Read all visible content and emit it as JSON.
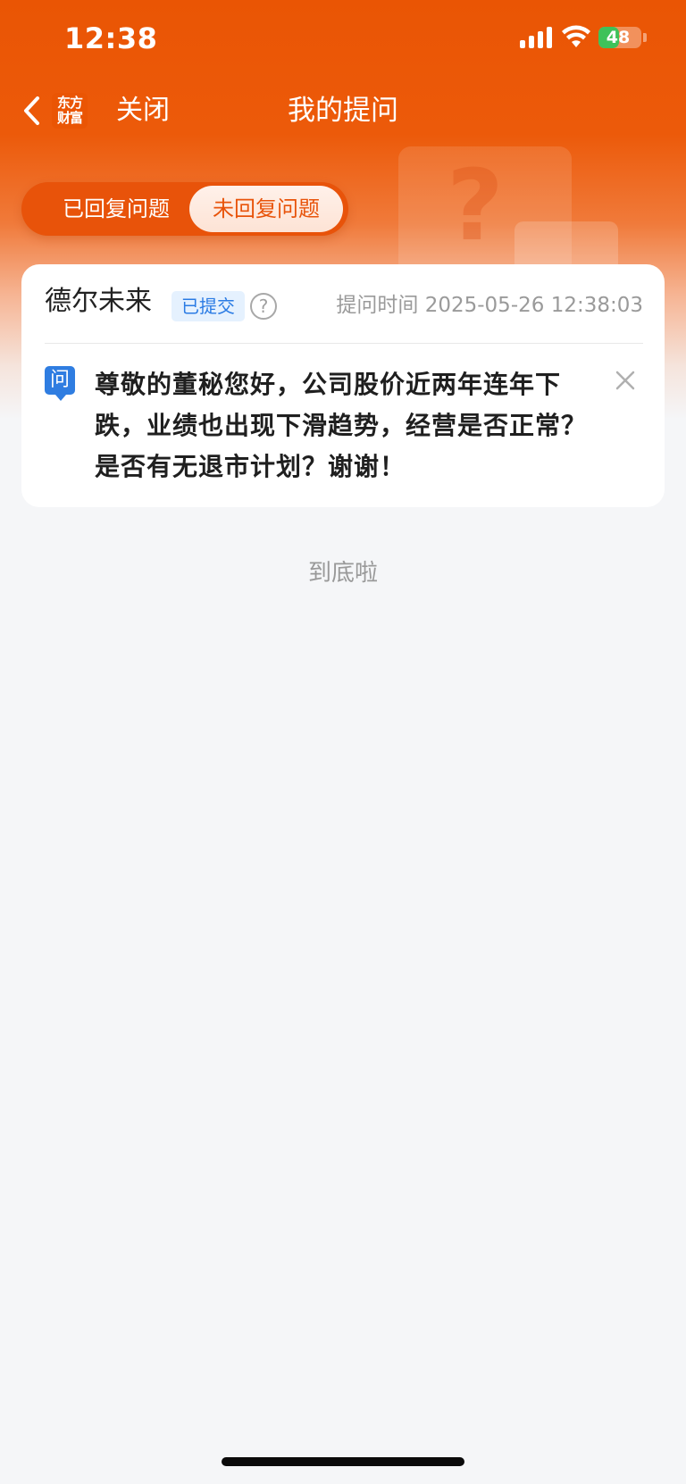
{
  "status_bar": {
    "time": "12:38",
    "battery_level": "48",
    "battery_fraction": 0.48,
    "icons": [
      "signal-icon",
      "wifi-icon",
      "battery-charging-icon"
    ]
  },
  "nav": {
    "back_icon": "chevron-left-icon",
    "brand_logo_lines": [
      "东方",
      "财富"
    ],
    "close_label": "关闭",
    "title": "我的提问"
  },
  "tabs": [
    {
      "label": "已回复问题",
      "active": false
    },
    {
      "label": "未回复问题",
      "active": true
    }
  ],
  "question_card": {
    "company": "德尔未来",
    "status": "已提交",
    "help_icon": "?",
    "time_label": "提问时间 2025-05-26 12:38:03",
    "q_badge": "问",
    "question": "尊敬的董秘您好，公司股价近两年连年下跌，业绩也出现下滑趋势，经营是否正常？是否有无退市计划？谢谢！",
    "close_icon": "close-icon"
  },
  "end_text": "到底啦",
  "colors": {
    "brand_orange": "#ea5504",
    "badge_blue": "#2f7de1",
    "background": "#f5f6f8"
  }
}
